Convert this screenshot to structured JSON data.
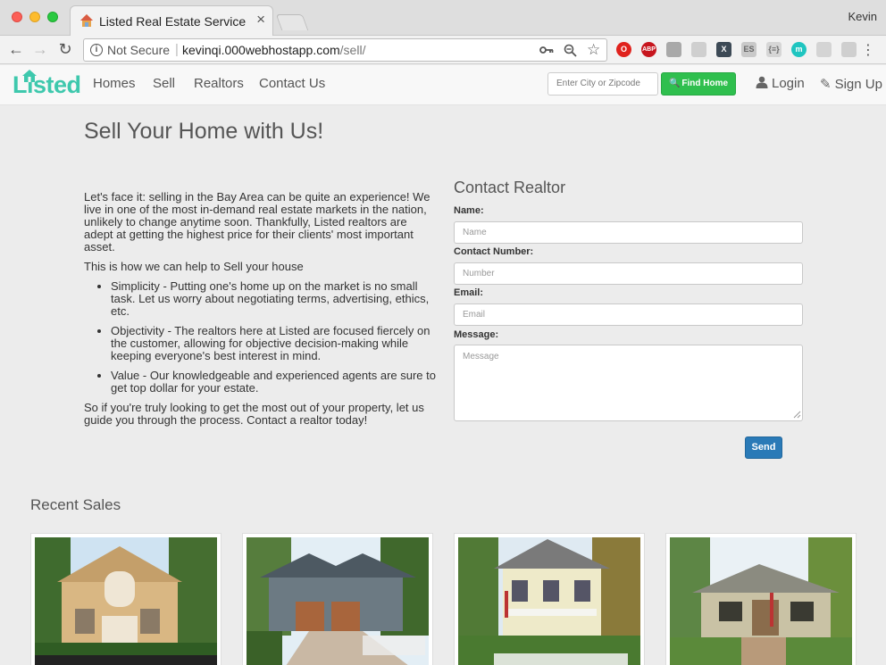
{
  "browser": {
    "tab_title": "Listed Real Estate Service",
    "tab_close": "×",
    "profile_name": "Kevin",
    "security_label": "Not Secure",
    "url_host": "kevinqi.000webhostapp.com",
    "url_path": "/sell/",
    "extensions": [
      {
        "name": "opera-icon",
        "label": "O",
        "color": "#e0221d"
      },
      {
        "name": "adblock-icon",
        "label": "ABP",
        "color": "#c7161e"
      },
      {
        "name": "shield-extension-icon",
        "label": "",
        "color": "#a9a9a9"
      },
      {
        "name": "download-extension-icon",
        "label": "",
        "color": "#cfcfcf"
      },
      {
        "name": "x-extension-icon",
        "label": "X",
        "color": "#3d4a56"
      },
      {
        "name": "es-extension-icon",
        "label": "ES",
        "color": "#c9c9c9"
      },
      {
        "name": "json-extension-icon",
        "label": "{≡}",
        "color": "#d6d6d6"
      },
      {
        "name": "m-extension-icon",
        "label": "m",
        "color": "#1fc5c0"
      },
      {
        "name": "ghost-extension-icon",
        "label": "",
        "color": "#d4d4d4"
      },
      {
        "name": "grid-extension-icon",
        "label": "",
        "color": "#cfcfcf"
      }
    ]
  },
  "nav": {
    "logo_text": "Listed",
    "links": [
      "Homes",
      "Sell",
      "Realtors",
      "Contact Us"
    ],
    "search_placeholder": "Enter City or Zipcode",
    "find_button": "Find Home",
    "login": "Login",
    "signup": "Sign Up"
  },
  "page": {
    "title": "Sell Your Home with Us!",
    "intro_paragraph": "Let's face it: selling in the Bay Area can be quite an experience! We live in one of the most in-demand real estate markets in the nation, unlikely to change anytime soon. Thankfully, Listed realtors are adept at getting the highest price for their clients' most important asset.",
    "how_heading": "This is how we can help to Sell your house",
    "bullets": [
      "Simplicity - Putting one's home up on the market is no small task. Let us worry about negotiating terms, advertising, ethics, etc.",
      "Objectivity - The realtors here at Listed are focused fiercely on the customer, allowing for objective decision-making while keeping everyone's best interest in mind.",
      "Value - Our knowledgeable and experienced agents are sure to get top dollar for your estate."
    ],
    "closing": "So if you're truly looking to get the most out of your property, let us guide you through the process. Contact a realtor today!"
  },
  "form": {
    "title": "Contact Realtor",
    "name_label": "Name:",
    "name_placeholder": "Name",
    "number_label": "Contact Number:",
    "number_placeholder": "Number",
    "email_label": "Email:",
    "email_placeholder": "Email",
    "message_label": "Message:",
    "message_placeholder": "Message",
    "send": "Send"
  },
  "recent": {
    "title": "Recent Sales",
    "cards": [
      {
        "name": "recent-sale-photo-1"
      },
      {
        "name": "recent-sale-photo-2"
      },
      {
        "name": "recent-sale-photo-3"
      },
      {
        "name": "recent-sale-photo-4"
      }
    ]
  }
}
